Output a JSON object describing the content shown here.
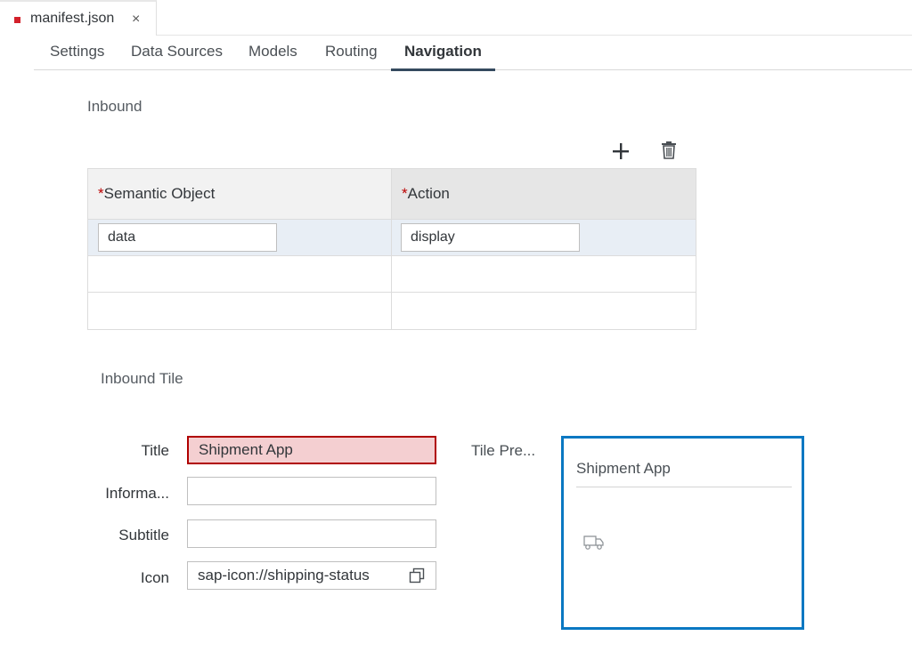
{
  "file_tab": {
    "name": "manifest.json",
    "close_glyph": "×"
  },
  "editor_tabs": [
    {
      "label": "Settings"
    },
    {
      "label": "Data Sources"
    },
    {
      "label": "Models"
    },
    {
      "label": "Routing"
    },
    {
      "label": "Navigation",
      "active": true
    }
  ],
  "inbound": {
    "section_label": "Inbound",
    "columns": [
      {
        "required_mark": "*",
        "label": "Semantic Object"
      },
      {
        "required_mark": "*",
        "label": "Action"
      }
    ],
    "rows": [
      {
        "semantic_object": "data",
        "action": "display"
      }
    ],
    "toolbar": {
      "add_icon": "plus-icon",
      "delete_icon": "trash-icon"
    }
  },
  "inbound_tile": {
    "section_label": "Inbound Tile",
    "fields": {
      "title_label": "Title",
      "title_value": "Shipment App",
      "information_label": "Informa...",
      "information_value": "",
      "subtitle_label": "Subtitle",
      "subtitle_value": "",
      "icon_label": "Icon",
      "icon_value": "sap-icon://shipping-status"
    },
    "preview_label": "Tile Pre...",
    "preview": {
      "title": "Shipment App",
      "icon": "shipping-truck-icon"
    }
  },
  "colors": {
    "active_tab_underline": "#354a5f",
    "error_border": "#b00000",
    "error_background": "#f4cfd1",
    "tile_border": "#0a78c2",
    "required_mark": "#bb0000"
  }
}
